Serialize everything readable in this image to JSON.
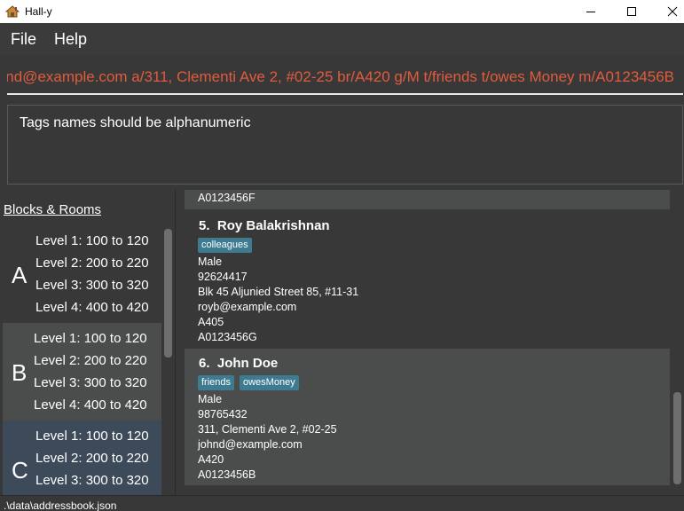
{
  "window": {
    "title": "Hall-y",
    "icon": "house-icon"
  },
  "menu": {
    "file": "File",
    "help": "Help"
  },
  "command_box": {
    "value": "nd@example.com a/311, Clementi Ave 2, #02-25 br/A420 g/M t/friends t/owes Money m/A0123456B",
    "text_color": "#e25b3c"
  },
  "result_display": {
    "text": "Tags names should be alphanumeric"
  },
  "left_panel": {
    "heading": "Blocks & Rooms",
    "blocks": [
      {
        "letter": "A",
        "color": "#383838",
        "levels": [
          "Level 1: 100 to 120",
          "Level 2: 200 to 220",
          "Level 3: 300 to 320",
          "Level 4: 400 to 420"
        ]
      },
      {
        "letter": "B",
        "color": "#4b4d4d",
        "levels": [
          "Level 1: 100 to 120",
          "Level 2: 200 to 220",
          "Level 3: 300 to 320",
          "Level 4: 400 to 420"
        ]
      },
      {
        "letter": "C",
        "color": "#3d4a5a",
        "levels": [
          "Level 1: 100 to 120",
          "Level 2: 200 to 220",
          "Level 3: 300 to 320"
        ]
      }
    ]
  },
  "person_list": {
    "partial_top_text": "A0123456F",
    "persons": [
      {
        "index": "5.",
        "name": "Roy Balakrishnan",
        "tags": [
          "colleagues"
        ],
        "gender": "Male",
        "phone": "92624417",
        "address": "Blk 45 Aljunied Street 85, #11-31",
        "email": "royb@example.com",
        "room": "A405",
        "matric": "A0123456G"
      },
      {
        "index": "6.",
        "name": "John Doe",
        "tags": [
          "friends",
          "owesMoney"
        ],
        "gender": "Male",
        "phone": "98765432",
        "address": "311, Clementi Ave 2, #02-25",
        "email": "johnd@example.com",
        "room": "A420",
        "matric": "A0123456B"
      }
    ],
    "tag_color": "#3e7b91"
  },
  "status_bar": {
    "path": ".\\data\\addressbook.json"
  }
}
